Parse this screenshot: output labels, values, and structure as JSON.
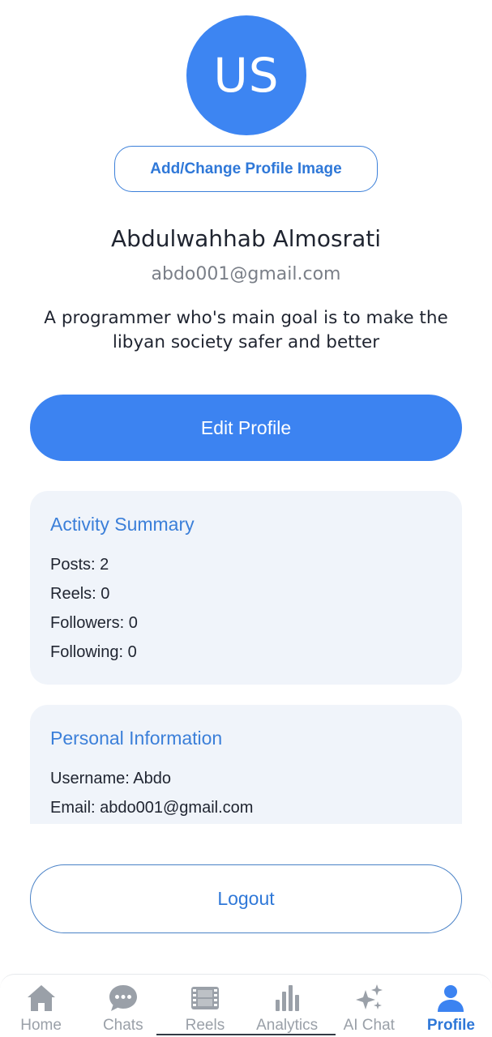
{
  "profile": {
    "initials": "US",
    "change_image_label": "Add/Change Profile Image",
    "full_name": "Abdulwahhab Almosrati",
    "email": "abdo001@gmail.com",
    "bio_line1": "A programmer who's main goal is to make the",
    "bio_line2": "libyan society safer and better",
    "edit_label": "Edit Profile"
  },
  "activity": {
    "title": "Activity Summary",
    "posts": "Posts: 2",
    "reels": "Reels: 0",
    "followers": "Followers: 0",
    "following": "Following: 0"
  },
  "personal": {
    "title": "Personal Information",
    "username": "Username: Abdo",
    "email": "Email: abdo001@gmail.com"
  },
  "logout_label": "Logout",
  "nav": {
    "items": [
      {
        "label": "Home",
        "icon": "home-icon"
      },
      {
        "label": "Chats",
        "icon": "chat-bubble-icon"
      },
      {
        "label": "Reels",
        "icon": "film-icon"
      },
      {
        "label": "Analytics",
        "icon": "bar-chart-icon"
      },
      {
        "label": "AI Chat",
        "icon": "sparkles-icon"
      },
      {
        "label": "Profile",
        "icon": "person-icon",
        "active": true
      }
    ]
  },
  "colors": {
    "accent": "#3c83f1",
    "accent_text": "#2f78d8",
    "inactive": "#9aa0a8",
    "card_bg": "#f0f4fa"
  }
}
